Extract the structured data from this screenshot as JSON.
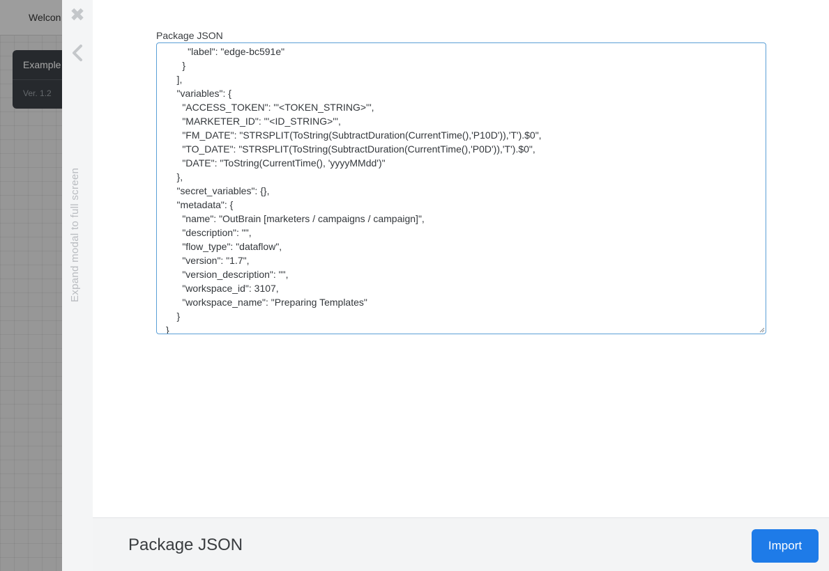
{
  "background": {
    "title": "Welcon",
    "card": {
      "title": "Example",
      "version": "Ver. 1.2"
    }
  },
  "modal": {
    "rail": {
      "close_icon": "close-icon",
      "collapse_icon": "chevron-left-icon",
      "expand_label": "Expand modal to full screen"
    },
    "field_label": "Package JSON",
    "json_text": "        \"label\": \"edge-bc591e\"\n      }\n    ],\n    \"variables\": {\n      \"ACCESS_TOKEN\": \"'<TOKEN_STRING>'\",\n      \"MARKETER_ID\": \"'<ID_STRING>'\",\n      \"FM_DATE\": \"STRSPLIT(ToString(SubtractDuration(CurrentTime(),'P10D')),'T').$0\",\n      \"TO_DATE\": \"STRSPLIT(ToString(SubtractDuration(CurrentTime(),'P0D')),'T').$0\",\n      \"DATE\": \"ToString(CurrentTime(), 'yyyyMMdd')\"\n    },\n    \"secret_variables\": {},\n    \"metadata\": {\n      \"name\": \"OutBrain [marketers / campaigns / campaign]\",\n      \"description\": \"\",\n      \"flow_type\": \"dataflow\",\n      \"version\": \"1.7\",\n      \"version_description\": \"\",\n      \"workspace_id\": 3107,\n      \"workspace_name\": \"Preparing Templates\"\n    }\n}",
    "footer": {
      "title": "Package JSON",
      "import_label": "Import"
    }
  },
  "colors": {
    "accent": "#1e7be8",
    "editor_border": "#5b9fd6",
    "footer_bg": "#f3f4f5"
  }
}
